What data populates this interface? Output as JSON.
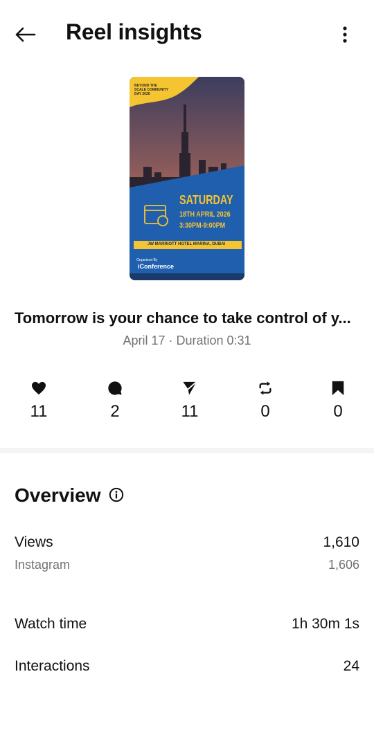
{
  "header": {
    "title": "Reel insights"
  },
  "thumbnail": {
    "top_text": "BEYOND THE SCALE COMMUNITY DAY 2026",
    "day": "SATURDAY",
    "date": "18TH APRIL 2026",
    "time": "3:30PM-9:00PM",
    "venue": "JW MARRIOTT HOTEL MARINA, DUBAI",
    "organized_by": "Organized By",
    "organizer": "iConference"
  },
  "reel": {
    "caption": "Tomorrow is your chance to take control of y...",
    "meta": "April 17 · Duration 0:31"
  },
  "stats": [
    {
      "icon": "heart-icon",
      "value": "11"
    },
    {
      "icon": "comment-icon",
      "value": "2"
    },
    {
      "icon": "send-icon",
      "value": "11"
    },
    {
      "icon": "repost-icon",
      "value": "0"
    },
    {
      "icon": "bookmark-icon",
      "value": "0"
    }
  ],
  "overview": {
    "title": "Overview",
    "views_label": "Views",
    "views_value": "1,610",
    "instagram_label": "Instagram",
    "instagram_value": "1,606",
    "watch_time_label": "Watch time",
    "watch_time_value": "1h 30m 1s",
    "interactions_label": "Interactions",
    "interactions_value": "24"
  },
  "colors": {
    "accent_blue": "#1f5fae",
    "accent_yellow": "#f5c431",
    "muted_text": "#737373"
  }
}
